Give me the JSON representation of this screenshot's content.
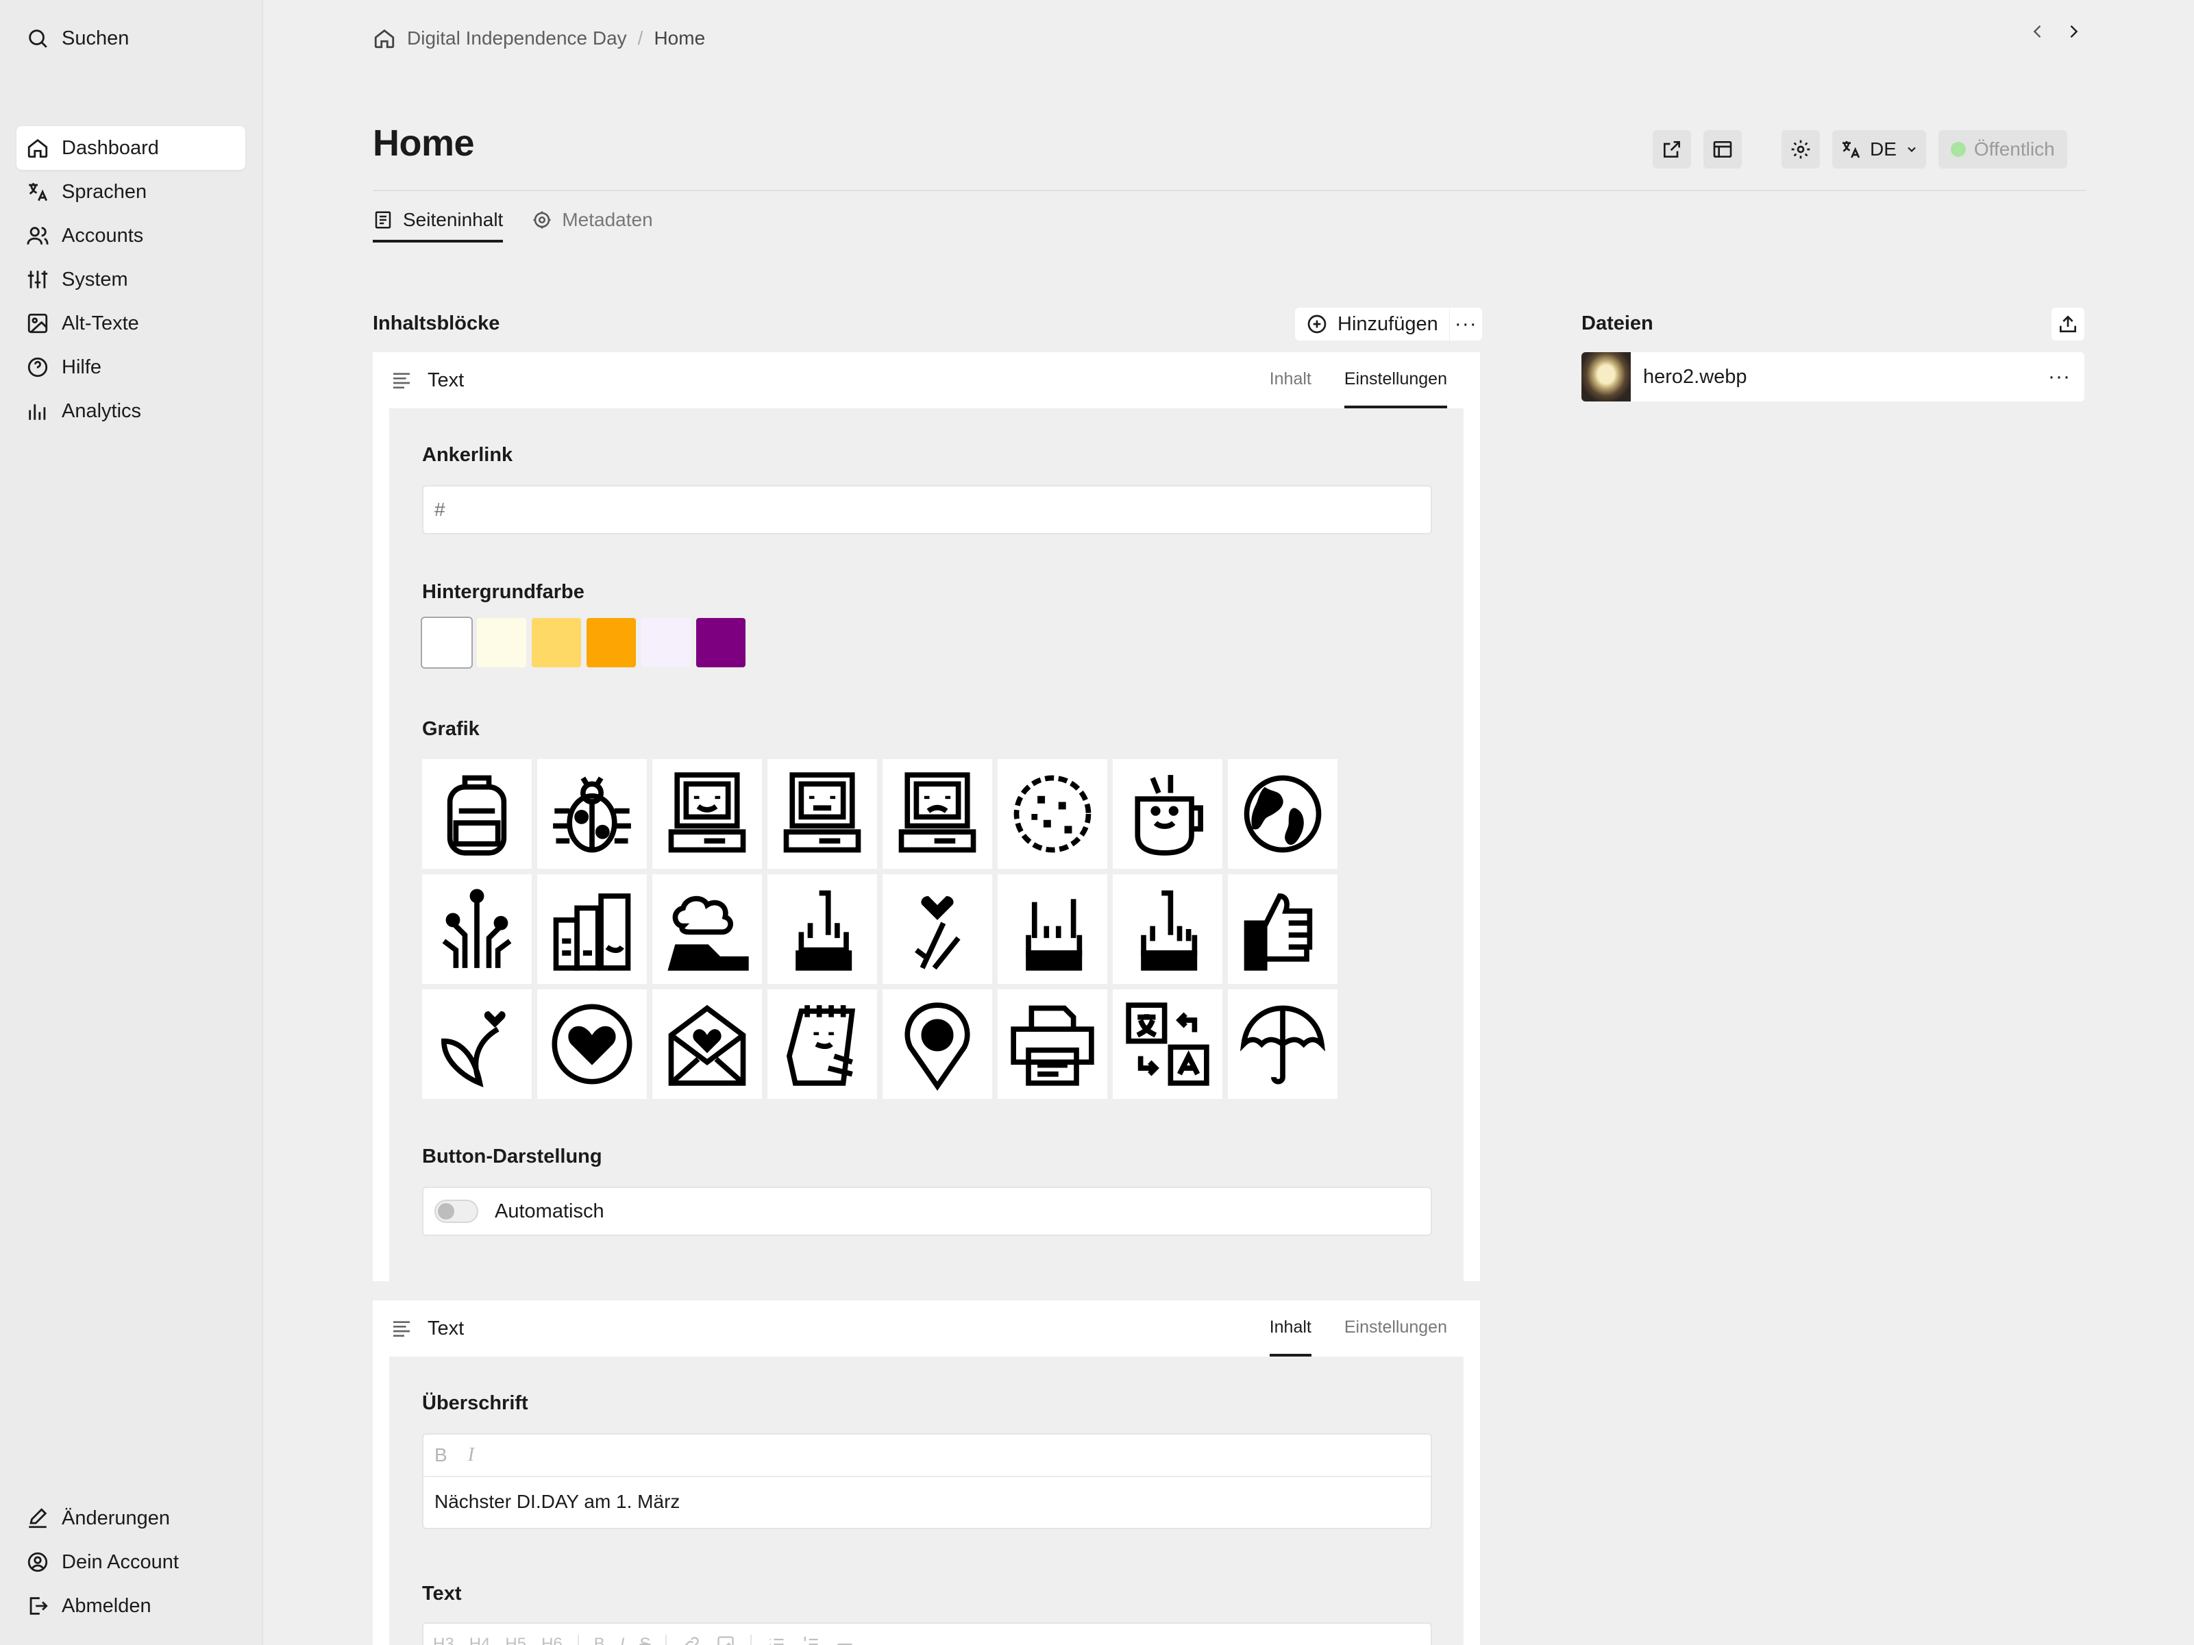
{
  "sidebar": {
    "search_label": "Suchen",
    "items": [
      {
        "label": "Dashboard",
        "icon": "home-icon"
      },
      {
        "label": "Sprachen",
        "icon": "translate-icon"
      },
      {
        "label": "Accounts",
        "icon": "users-icon"
      },
      {
        "label": "System",
        "icon": "sliders-icon"
      },
      {
        "label": "Alt-Texte",
        "icon": "image-icon"
      },
      {
        "label": "Hilfe",
        "icon": "help-circle-icon"
      },
      {
        "label": "Analytics",
        "icon": "bar-chart-icon"
      }
    ],
    "active_item": "Dashboard",
    "bottom_items": [
      {
        "label": "Änderungen",
        "icon": "edit-icon"
      },
      {
        "label": "Dein Account",
        "icon": "user-circle-icon"
      },
      {
        "label": "Abmelden",
        "icon": "logout-icon"
      }
    ]
  },
  "breadcrumb": {
    "site": "Digital Independence Day",
    "separator": "/",
    "page": "Home"
  },
  "page": {
    "title": "Home"
  },
  "toolbar": {
    "language": "DE",
    "status": "Öffentlich",
    "status_color": "#a9e5a0"
  },
  "tabs": [
    {
      "label": "Seiteninhalt",
      "icon": "document-icon",
      "active": true
    },
    {
      "label": "Metadaten",
      "icon": "gear-icon",
      "active": false
    }
  ],
  "blocks_section": {
    "label": "Inhaltsblöcke",
    "add_label": "Hinzufügen",
    "more": "···"
  },
  "files_section": {
    "label": "Dateien",
    "files": [
      {
        "name": "hero2.webp",
        "more": "···"
      }
    ]
  },
  "block1": {
    "type_label": "Text",
    "tabs": [
      "Inhalt",
      "Einstellungen"
    ],
    "active_tab": "Einstellungen",
    "anchor": {
      "label": "Ankerlink",
      "placeholder": "#"
    },
    "background": {
      "label": "Hintergrundfarbe",
      "selected": "#ffffff",
      "colors": [
        "#ffffff",
        "#fefbe6",
        "#fed966",
        "#fda502",
        "#f6f0fd",
        "#7d0080"
      ]
    },
    "graphic": {
      "label": "Grafik",
      "icons": [
        "backpack-icon",
        "bug-icon",
        "computer-smile-icon",
        "computer-neutral-icon",
        "computer-sad-icon",
        "cookie-icon",
        "mug-icon",
        "globe-icon",
        "circuit-icon",
        "folders-icon",
        "cloud-hand-icon",
        "middle-finger-hand-icon",
        "fingers-crossed-icon",
        "rock-hand-icon",
        "pointing-hand-icon",
        "thumbs-up-icon",
        "leaf-heart-icon",
        "heart-circle-icon",
        "love-letter-icon",
        "notepad-icon",
        "map-pin-icon",
        "printer-icon",
        "translate-icon",
        "umbrella-icon"
      ]
    },
    "button_style": {
      "label": "Button-Darstellung",
      "value": "Automatisch",
      "toggle_on": false
    }
  },
  "block2": {
    "type_label": "Text",
    "tabs": [
      "Inhalt",
      "Einstellungen"
    ],
    "active_tab": "Inhalt",
    "heading": {
      "label": "Überschrift",
      "bold": "B",
      "italic": "I",
      "value": "Nächster DI.DAY am 1. März"
    },
    "text": {
      "label": "Text",
      "toolbar": [
        "H3",
        "H4",
        "H5",
        "H6",
        "B",
        "I",
        "S"
      ]
    }
  }
}
